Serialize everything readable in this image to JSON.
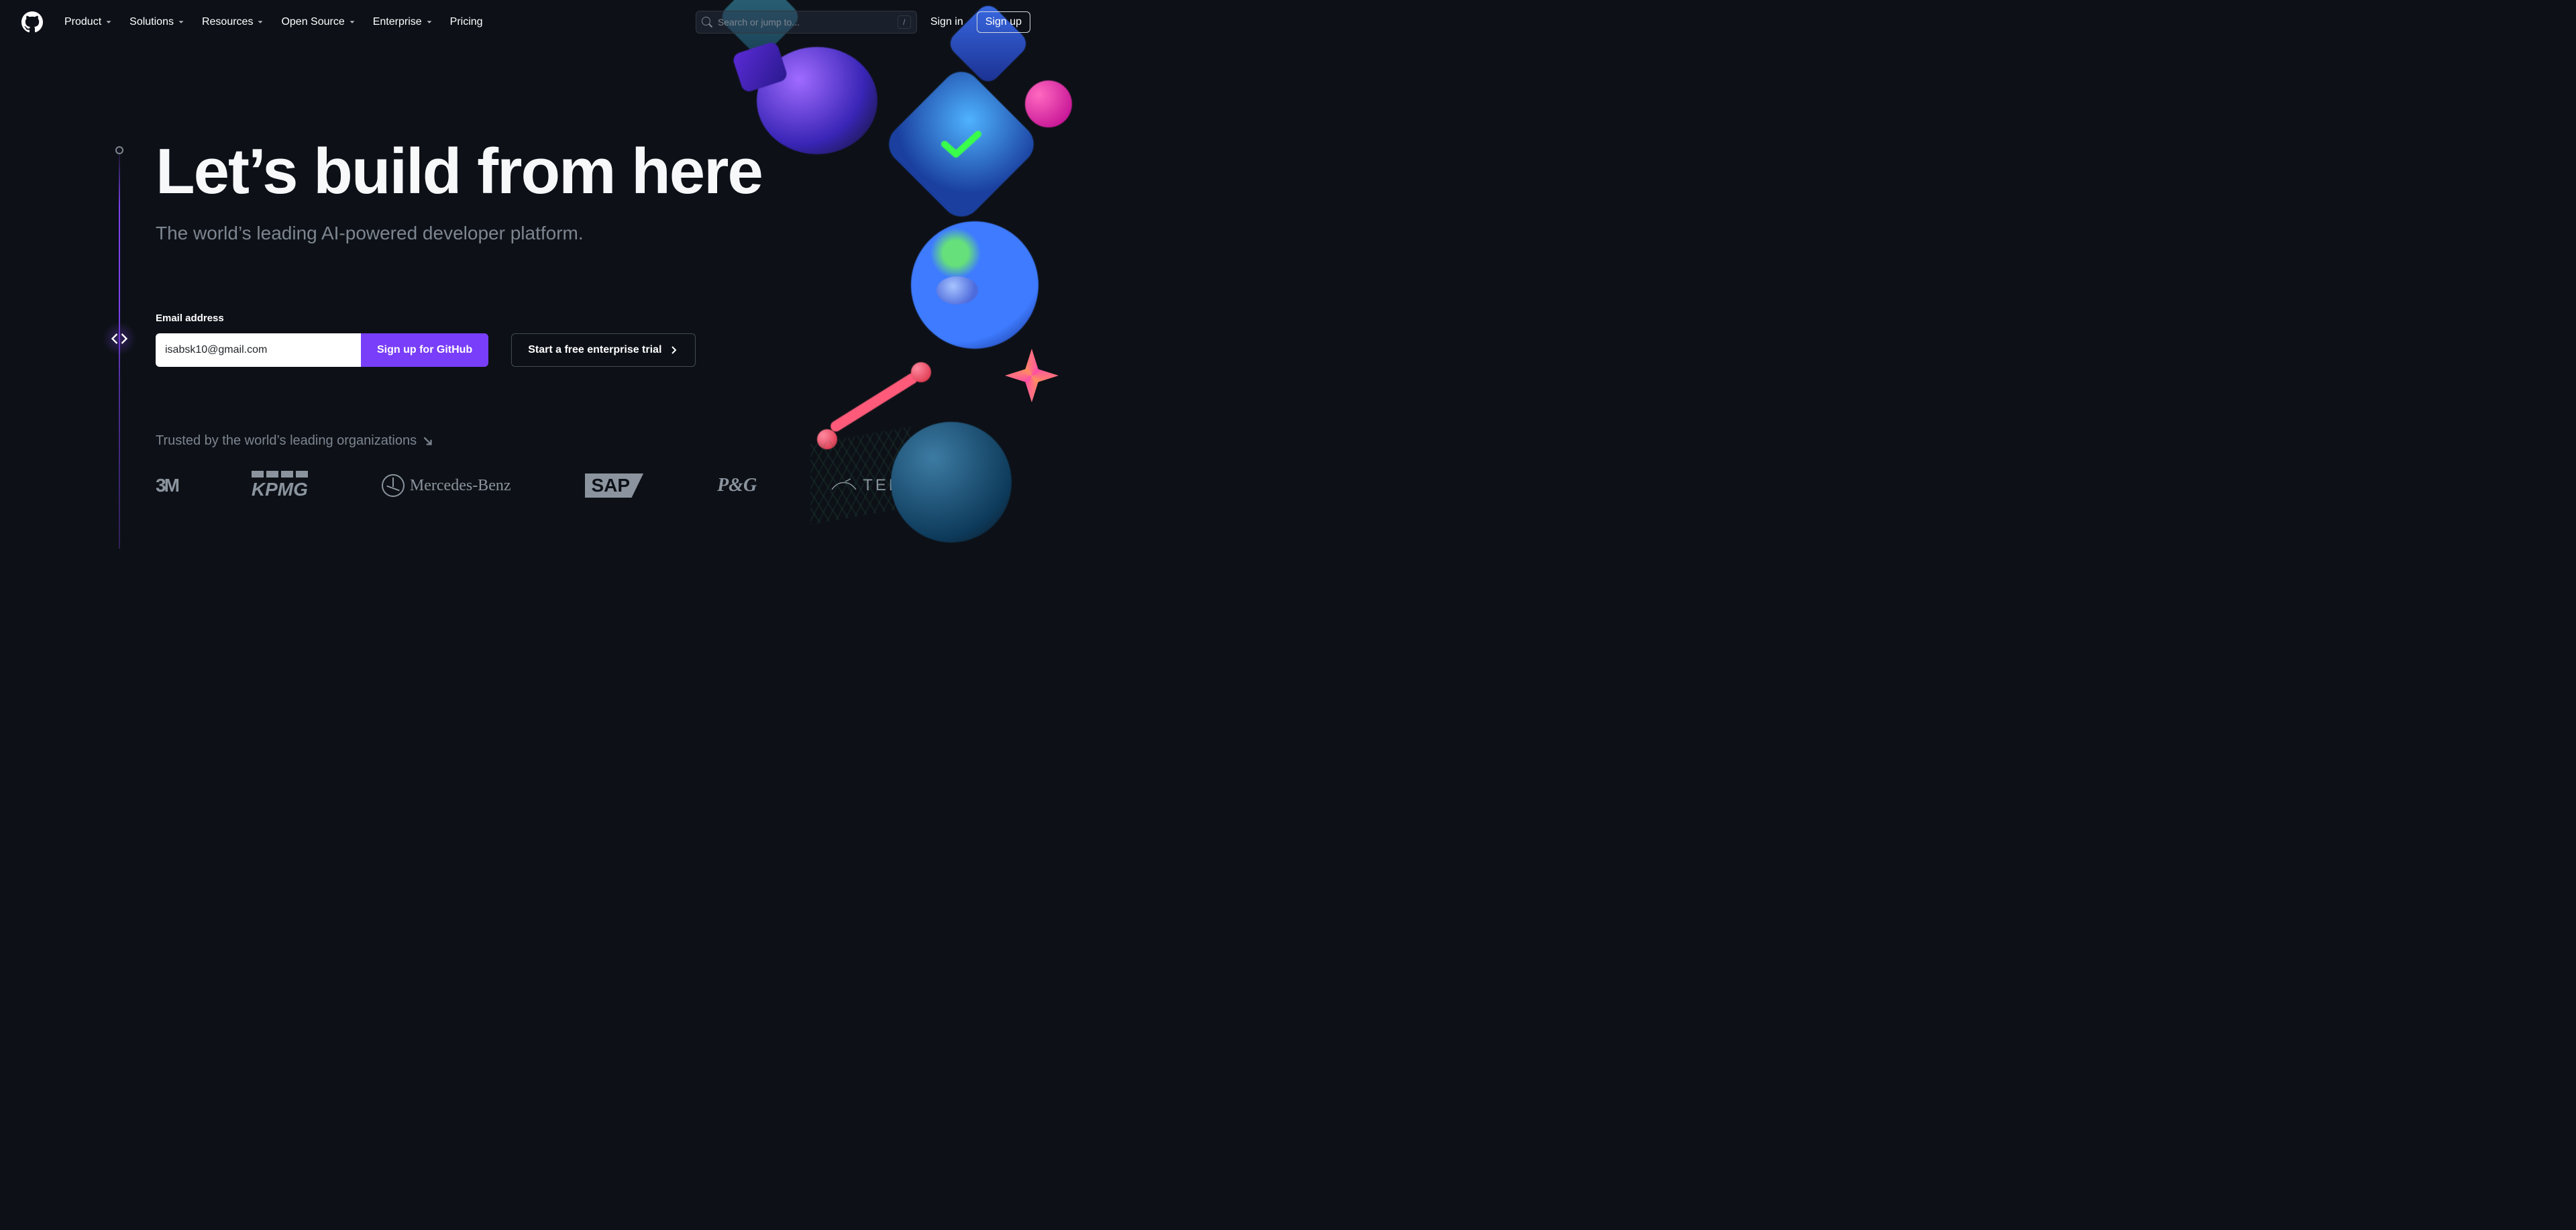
{
  "nav": {
    "items": [
      {
        "label": "Product"
      },
      {
        "label": "Solutions"
      },
      {
        "label": "Resources"
      },
      {
        "label": "Open Source"
      },
      {
        "label": "Enterprise"
      },
      {
        "label": "Pricing",
        "no_chevron": true
      }
    ]
  },
  "search": {
    "placeholder": "Search or jump to...",
    "shortcut": "/"
  },
  "auth": {
    "signin": "Sign in",
    "signup": "Sign up"
  },
  "hero": {
    "headline": "Let’s build from here",
    "subhead": "The world’s leading AI-powered developer platform."
  },
  "form": {
    "email_label": "Email address",
    "email_value": "isabsk10@gmail.com",
    "signup_label": "Sign up for GitHub",
    "enterprise_label": "Start a free enterprise trial"
  },
  "trusted": {
    "text": "Trusted by the world’s leading organizations"
  },
  "logos": {
    "items": [
      {
        "name": "3M"
      },
      {
        "name": "KPMG"
      },
      {
        "name": "Mercedes-Benz"
      },
      {
        "name": "SAP"
      },
      {
        "name": "P&G"
      },
      {
        "name": "TELUS"
      }
    ]
  }
}
